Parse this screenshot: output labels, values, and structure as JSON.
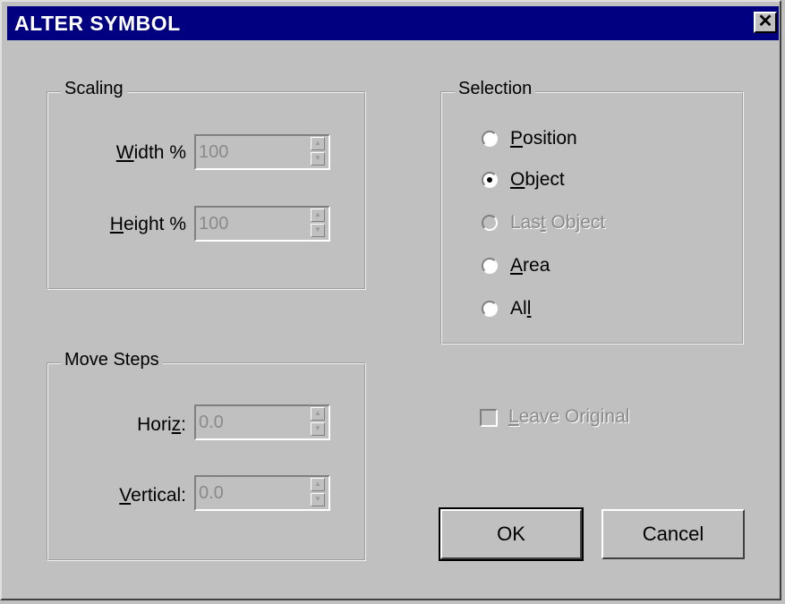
{
  "window": {
    "title": "ALTER SYMBOL",
    "close_glyph": "✕"
  },
  "scaling": {
    "legend": "Scaling",
    "width": {
      "label_hot": "W",
      "label_rest": "idth %",
      "value": "100"
    },
    "height": {
      "label_hot": "H",
      "label_rest": "eight %",
      "value": "100"
    }
  },
  "move_steps": {
    "legend": "Move Steps",
    "horiz": {
      "label_pre": "Hori",
      "label_hot": "z",
      "label_post": ":",
      "value": "0.0"
    },
    "vertical": {
      "label_hot": "V",
      "label_rest": "ertical:",
      "value": "0.0"
    }
  },
  "selection": {
    "legend": "Selection",
    "options": [
      {
        "hot": "P",
        "rest": "osition",
        "checked": false,
        "enabled": true
      },
      {
        "hot": "O",
        "rest": "bject",
        "checked": true,
        "enabled": true
      },
      {
        "pre": "Las",
        "hot": "t",
        "rest": " Object",
        "checked": false,
        "enabled": false
      },
      {
        "hot": "A",
        "rest": "rea",
        "checked": false,
        "enabled": true
      },
      {
        "pre": "Al",
        "hot": "l",
        "rest": "",
        "checked": false,
        "enabled": true
      }
    ]
  },
  "leave_original": {
    "hot": "L",
    "rest": "eave Original",
    "checked": false,
    "enabled": false
  },
  "buttons": {
    "ok": "OK",
    "cancel": "Cancel"
  }
}
